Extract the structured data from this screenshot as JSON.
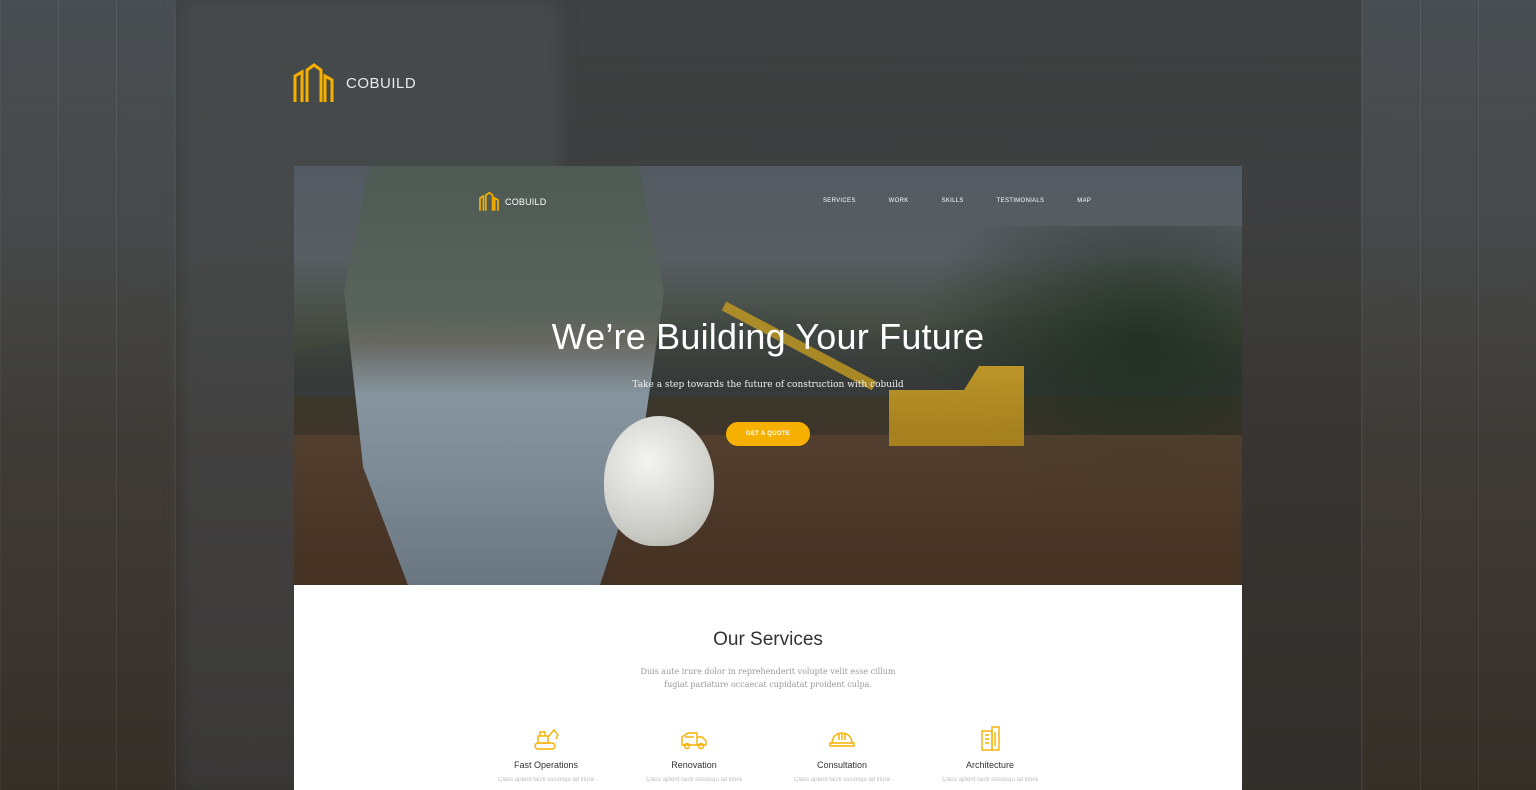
{
  "outer": {
    "brand": "COBUILD"
  },
  "nav": {
    "brand": "COBUILD",
    "items": [
      {
        "label": "SERVICES"
      },
      {
        "label": "WORK"
      },
      {
        "label": "SKILLS"
      },
      {
        "label": "TESTIMONIALS"
      },
      {
        "label": "MAP"
      }
    ]
  },
  "hero": {
    "title": "We’re Building Your Future",
    "subtitle": "Take a step towards the future of construction with cobuild",
    "cta_label": "GET A QUOTE"
  },
  "services": {
    "title": "Our Services",
    "description": "Duis aute irure dolor in reprehenderit volupte velit esse cillum fugiat pariature occaecat cupidatat proident culpa.",
    "cards": [
      {
        "icon": "excavator-icon",
        "name": "Fast Operations",
        "blurb": "Class aptent taciti sociosqu ad litora"
      },
      {
        "icon": "truck-icon",
        "name": "Renovation",
        "blurb": "Class aptent taciti sociosqu ad litora"
      },
      {
        "icon": "hard-hat-icon",
        "name": "Consultation",
        "blurb": "Class aptent taciti sociosqu ad litora"
      },
      {
        "icon": "building-icon",
        "name": "Architecture",
        "blurb": "Class aptent taciti sociosqu ad litora"
      }
    ]
  },
  "colors": {
    "accent": "#f6b100",
    "dark_text": "#333333",
    "muted_text": "#9a9a9a"
  }
}
